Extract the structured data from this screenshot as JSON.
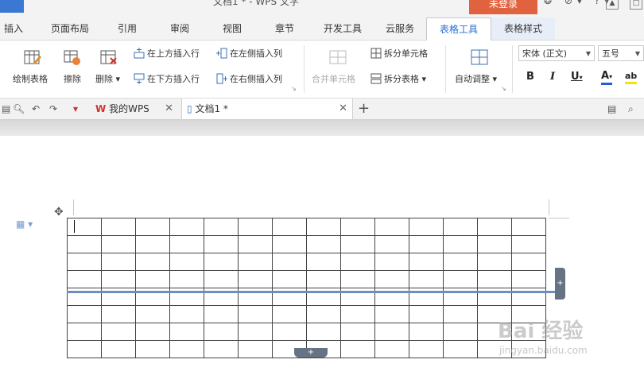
{
  "titlebar": {
    "doc_title": "文档1 * - WPS 文字",
    "login": "未登录",
    "icons": "❂ ⊘▾ ?▾"
  },
  "menu_tabs": [
    {
      "label": "插入"
    },
    {
      "label": "页面布局"
    },
    {
      "label": "引用"
    },
    {
      "label": "审阅"
    },
    {
      "label": "视图"
    },
    {
      "label": "章节"
    },
    {
      "label": "开发工具"
    },
    {
      "label": "云服务"
    },
    {
      "label": "表格工具"
    },
    {
      "label": "表格样式"
    }
  ],
  "ribbon": {
    "draw_table": "绘制表格",
    "erase": "擦除",
    "delete": "删除",
    "insert_above": "在上方插入行",
    "insert_below": "在下方插入行",
    "insert_left": "在左侧插入列",
    "insert_right": "在右侧插入列",
    "merge_cells": "合并单元格",
    "split_cells": "拆分单元格",
    "split_table": "拆分表格",
    "auto_fit": "自动调整",
    "font_name": "宋体 (正文)",
    "font_size": "五号",
    "bold": "B",
    "italic": "I",
    "underline": "U",
    "font_color": "A",
    "highlight": "ab"
  },
  "doc_tabs": [
    {
      "label": "我的WPS"
    },
    {
      "label": "文档1 *"
    }
  ],
  "table": {
    "rows": 8,
    "cols": 14
  },
  "watermark": {
    "text": "Bai 经验",
    "sub": "jingyan.baidu.com"
  },
  "colors": {
    "accent": "#2a6fd1",
    "login": "#e0623e",
    "selection": "#6d8fbf"
  }
}
